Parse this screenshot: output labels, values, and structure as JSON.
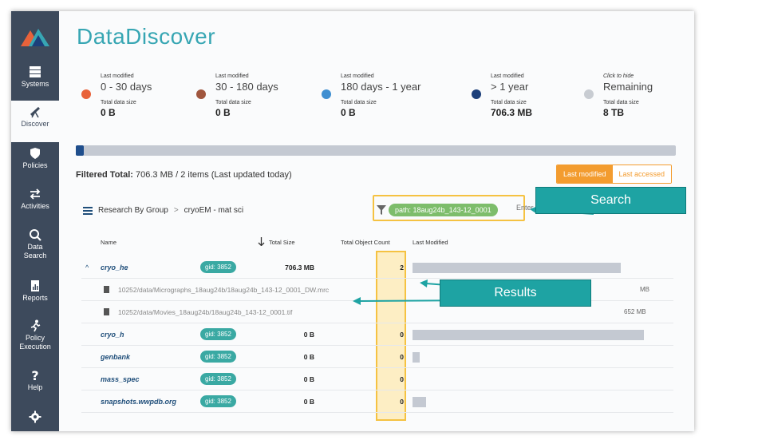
{
  "app": {
    "title": "DataDiscover"
  },
  "sidebar": {
    "items": [
      {
        "label": "Systems",
        "icon": "server-icon"
      },
      {
        "label": "Discover",
        "icon": "telescope-icon",
        "active": true
      },
      {
        "label": "Policies",
        "icon": "shield-icon"
      },
      {
        "label": "Activities",
        "icon": "arrows-icon"
      },
      {
        "label": "Data",
        "label2": "Search",
        "icon": "search-icon"
      },
      {
        "label": "Reports",
        "icon": "report-icon"
      },
      {
        "label": "Policy",
        "label2": "Execution",
        "icon": "runner-icon"
      },
      {
        "label": "Help",
        "icon": "question-icon"
      },
      {
        "label": "",
        "icon": "gear-icon"
      }
    ]
  },
  "tiles": [
    {
      "label": "Last modified",
      "range": "0 - 30 days",
      "size_label": "Total data size",
      "size": "0 B",
      "color": "#e8623a"
    },
    {
      "label": "Last modified",
      "range": "30 - 180 days",
      "size_label": "Total data size",
      "size": "0 B",
      "color": "#a0563e"
    },
    {
      "label": "Last modified",
      "range": "180 days - 1 year",
      "size_label": "Total data size",
      "size": "0 B",
      "color": "#3f8fd1"
    },
    {
      "label": "Last modified",
      "range": "> 1 year",
      "size_label": "Total data size",
      "size": "706.3 MB",
      "color": "#1c3f7a"
    },
    {
      "label": "Click to hide",
      "range": "Remaining",
      "size_label": "Total data size",
      "size": "8 TB",
      "color": "#c8ccd2"
    }
  ],
  "progress": {
    "fraction": 0.012
  },
  "filtered": {
    "label": "Filtered Total:",
    "value": "706.3 MB / 2 items (Last updated today)"
  },
  "toggle": {
    "active": "Last modified",
    "inactive": "Last accessed"
  },
  "breadcrumb": {
    "root": "Research By Group",
    "sep": ">",
    "current": "cryoEM - mat sci"
  },
  "filter": {
    "pill": "path: 18aug24b_143-12_0001",
    "placeholder": "Enter text to filter re"
  },
  "callouts": {
    "search": "Search",
    "results": "Results"
  },
  "table": {
    "headers": {
      "name": "Name",
      "size": "Total Size",
      "count": "Total Object Count",
      "modified": "Last Modified"
    },
    "rows": [
      {
        "name": "cryo_he",
        "gid": "gid: 3852",
        "size": "706.3 MB",
        "count": "2",
        "bar_fraction": 0.9,
        "expanded": true
      },
      {
        "name": "cryo_h",
        "gid": "gid: 3852",
        "size": "0 B",
        "count": "0",
        "bar_fraction": 1.0
      },
      {
        "name": "genbank",
        "gid": "gid: 3852",
        "size": "0 B",
        "count": "0",
        "bar_fraction": 0.03
      },
      {
        "name": "mass_spec",
        "gid": "gid: 3852",
        "size": "0 B",
        "count": "0",
        "bar_fraction": 0.0
      },
      {
        "name": "snapshots.wwpdb.org",
        "gid": "gid: 3852",
        "size": "0 B",
        "count": "0",
        "bar_fraction": 0.06
      }
    ],
    "files": [
      {
        "path": "10252/data/Micrographs_18aug24b/18aug24b_143-12_0001_DW.mrc",
        "size": "MB"
      },
      {
        "path": "10252/data/Movies_18aug24b/18aug24b_143-12_0001.tif",
        "size": "652 MB"
      }
    ]
  }
}
